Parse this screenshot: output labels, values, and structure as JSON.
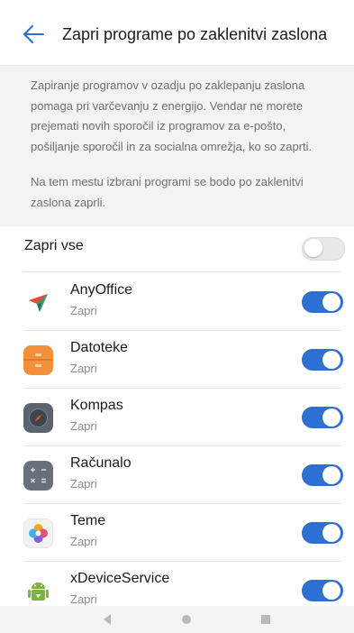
{
  "header": {
    "title": "Zapri programe po zaklenitvi zaslona",
    "back_icon": "back-arrow-icon"
  },
  "description": {
    "paragraph1": "Zapiranje programov v ozadju po zaklepanju zaslona pomaga pri varčevanju z energijo. Vendar ne morete prejemati novih sporočil iz programov za e-pošto, pošiljanje sporočil in za socialna omrežja, ko so zaprti.",
    "paragraph2": "Na tem mestu izbrani programi se bodo po zaklenitvi zaslona zaprli."
  },
  "close_all": {
    "label": "Zapri vse",
    "enabled": false
  },
  "apps": [
    {
      "name": "AnyOffice",
      "status": "Zapri",
      "icon": "anyoffice-icon",
      "enabled": true
    },
    {
      "name": "Datoteke",
      "status": "Zapri",
      "icon": "files-icon",
      "enabled": true
    },
    {
      "name": "Kompas",
      "status": "Zapri",
      "icon": "compass-icon",
      "enabled": true
    },
    {
      "name": "Računalo",
      "status": "Zapri",
      "icon": "calculator-icon",
      "enabled": true
    },
    {
      "name": "Teme",
      "status": "Zapri",
      "icon": "themes-icon",
      "enabled": true
    },
    {
      "name": "xDeviceService",
      "status": "Zapri",
      "icon": "android-icon",
      "enabled": true
    }
  ],
  "navbar": {
    "back": "nav-back-icon",
    "home": "nav-home-icon",
    "recents": "nav-recents-icon"
  },
  "colors": {
    "accent": "#2e6fd1",
    "toggle_off": "#e8e8e8",
    "description_bg": "#f3f3f3"
  }
}
